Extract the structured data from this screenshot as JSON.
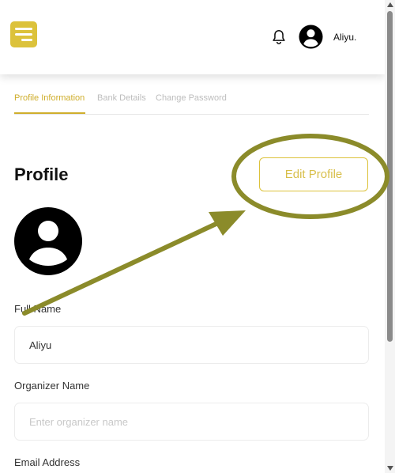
{
  "header": {
    "menu_icon": "hamburger-menu-icon",
    "notification_icon": "bell-icon",
    "avatar_icon": "user-avatar-icon",
    "username": "Aliyu."
  },
  "tabs": [
    {
      "label": "Profile Information",
      "active": true
    },
    {
      "label": "Bank Details",
      "active": false
    },
    {
      "label": "Change Password",
      "active": false
    }
  ],
  "profile": {
    "title": "Profile",
    "edit_button": "Edit Profile",
    "avatar_icon": "user-avatar-icon"
  },
  "form": {
    "full_name": {
      "label": "Full Name",
      "value": "Aliyu"
    },
    "organizer_name": {
      "label": "Organizer Name",
      "placeholder": "Enter organizer name"
    },
    "email": {
      "label": "Email Address"
    }
  },
  "colors": {
    "accent": "#dcc23b",
    "annotation": "#8b8b2a"
  }
}
